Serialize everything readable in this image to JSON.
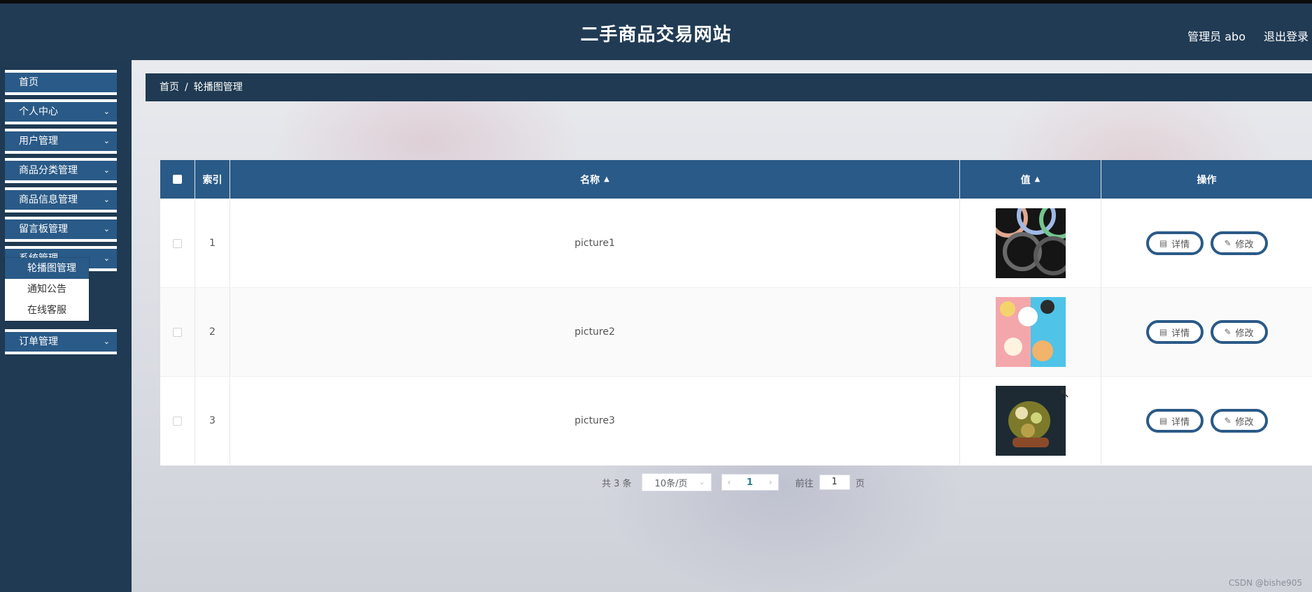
{
  "header": {
    "title": "二手商品交易网站",
    "user_label": "管理员 abo",
    "logout_label": "退出登录"
  },
  "sidebar": {
    "items": [
      {
        "label": "首页",
        "has_children": false
      },
      {
        "label": "个人中心",
        "has_children": true
      },
      {
        "label": "用户管理",
        "has_children": true
      },
      {
        "label": "商品分类管理",
        "has_children": true
      },
      {
        "label": "商品信息管理",
        "has_children": true
      },
      {
        "label": "留言板管理",
        "has_children": true
      },
      {
        "label": "系统管理",
        "has_children": true,
        "expanded": true
      },
      {
        "label": "订单管理",
        "has_children": true
      }
    ],
    "submenu": [
      {
        "label": "轮播图管理",
        "active": true
      },
      {
        "label": "通知公告",
        "active": false
      },
      {
        "label": "在线客服",
        "active": false
      }
    ],
    "chevron_icon": "chevron-down-icon"
  },
  "breadcrumb": {
    "home": "首页",
    "separator": "/",
    "current": "轮播图管理"
  },
  "table": {
    "columns": {
      "index": "索引",
      "name": "名称",
      "value": "值",
      "actions": "操作"
    },
    "rows": [
      {
        "index": "1",
        "name": "picture1",
        "image": "abstract-circles-dark"
      },
      {
        "index": "2",
        "name": "picture2",
        "image": "pink-blue-food"
      },
      {
        "index": "3",
        "name": "picture3",
        "image": "dark-food-closeup"
      }
    ],
    "detail_label": "详情",
    "edit_label": "修改"
  },
  "pagination": {
    "total_text": "共 3 条",
    "page_size": "10条/页",
    "current_page": "1",
    "goto_prefix": "前往",
    "goto_value": "1",
    "goto_suffix": "页"
  },
  "watermark": "CSDN @bishe905",
  "colors": {
    "header_bg": "#213b54",
    "accent": "#2a5a87",
    "sidebar_bg": "#1f3a52"
  }
}
